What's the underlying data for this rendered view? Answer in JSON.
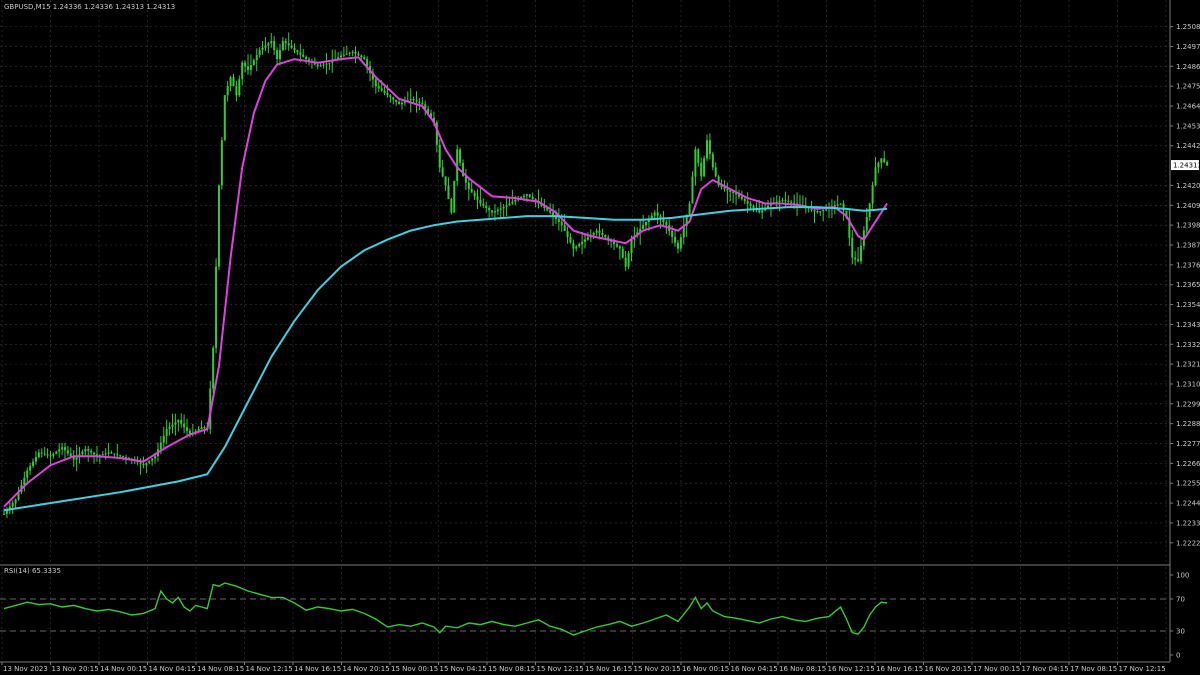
{
  "header": {
    "symbol_info": "GBPUSD,M15  1.24336 1.24336 1.24313 1.24313"
  },
  "rsi_panel": {
    "title": "RSI(14) 65.3335"
  },
  "colors": {
    "background": "#000000",
    "grid": "#3a3a3a",
    "candle": "#33cc33",
    "ma_fast": "#e040e0",
    "ma_slow": "#40d0e0",
    "rsi": "#33cc33",
    "price_tag_bg": "#ffffff",
    "price_tag_fg": "#000000"
  },
  "chart_data": [
    {
      "type": "line",
      "name": "price",
      "y_ticks": [
        "1.25080",
        "1.24970",
        "1.24860",
        "1.24750",
        "1.24640",
        "1.24530",
        "1.24420",
        "1.24200",
        "1.24090",
        "1.23980",
        "1.23870",
        "1.23760",
        "1.23650",
        "1.23540",
        "1.23430",
        "1.23320",
        "1.23210",
        "1.23100",
        "1.22990",
        "1.22880",
        "1.22770",
        "1.22660",
        "1.22550",
        "1.22440",
        "1.22330",
        "1.22220"
      ],
      "current_price": "1.24313",
      "ylim": [
        1.2218,
        1.2515
      ],
      "x_range": [
        0,
        100
      ],
      "x_ticks": [
        {
          "x": 0,
          "label": "13 Nov 2023"
        },
        {
          "x": 6.8,
          "label": "13 Nov 20:15"
        },
        {
          "x": 13.6,
          "label": "14 Nov 00:15"
        },
        {
          "x": 20.4,
          "label": "14 Nov 04:15"
        },
        {
          "x": 27.2,
          "label": "14 Nov 08:15"
        },
        {
          "x": 34.0,
          "label": "14 Nov 12:15"
        },
        {
          "x": 40.8,
          "label": "14 Nov 16:15"
        },
        {
          "x": 47.6,
          "label": "14 Nov 20:15"
        },
        {
          "x": 54.4,
          "label": "15 Nov 00:15"
        },
        {
          "x": 61.2,
          "label": "15 Nov 04:15"
        },
        {
          "x": 68.0,
          "label": "15 Nov 08:15"
        },
        {
          "x": 74.8,
          "label": "15 Nov 12:15"
        },
        {
          "x": 81.6,
          "label": "15 Nov 16:15"
        },
        {
          "x": 88.4,
          "label": "15 Nov 20:15"
        },
        {
          "x": 95.2,
          "label": "16 Nov 00:15"
        },
        {
          "x": 102.0,
          "label": "16 Nov 04:15"
        },
        {
          "x": 108.8,
          "label": "16 Nov 08:15"
        },
        {
          "x": 115.6,
          "label": "16 Nov 12:15"
        },
        {
          "x": 122.4,
          "label": "16 Nov 16:15"
        },
        {
          "x": 129.2,
          "label": "16 Nov 20:15"
        },
        {
          "x": 136.0,
          "label": "17 Nov 00:15"
        },
        {
          "x": 142.8,
          "label": "17 Nov 04:15"
        },
        {
          "x": 149.6,
          "label": "17 Nov 08:15"
        },
        {
          "x": 156.4,
          "label": "17 Nov 12:15"
        }
      ],
      "x_max": 200,
      "close": [
        [
          0,
          1.2238
        ],
        [
          2,
          1.2246
        ],
        [
          4,
          1.2262
        ],
        [
          6,
          1.2272
        ],
        [
          8,
          1.227
        ],
        [
          10,
          1.2275
        ],
        [
          12,
          1.2268
        ],
        [
          14,
          1.2274
        ],
        [
          16,
          1.227
        ],
        [
          18,
          1.2272
        ],
        [
          20,
          1.227
        ],
        [
          22,
          1.2268
        ],
        [
          24,
          1.2265
        ],
        [
          26,
          1.227
        ],
        [
          28,
          1.2285
        ],
        [
          30,
          1.229
        ],
        [
          32,
          1.2282
        ],
        [
          34,
          1.2286
        ],
        [
          35,
          1.2285
        ],
        [
          36,
          1.233
        ],
        [
          37,
          1.242
        ],
        [
          38,
          1.247
        ],
        [
          39,
          1.248
        ],
        [
          40,
          1.247
        ],
        [
          41,
          1.2488
        ],
        [
          42,
          1.2484
        ],
        [
          44,
          1.2495
        ],
        [
          46,
          1.25
        ],
        [
          47,
          1.249
        ],
        [
          48,
          1.25
        ],
        [
          50,
          1.2495
        ],
        [
          52,
          1.249
        ],
        [
          54,
          1.2486
        ],
        [
          56,
          1.2488
        ],
        [
          58,
          1.2492
        ],
        [
          60,
          1.2494
        ],
        [
          62,
          1.249
        ],
        [
          64,
          1.2475
        ],
        [
          66,
          1.247
        ],
        [
          68,
          1.2465
        ],
        [
          70,
          1.2468
        ],
        [
          72,
          1.2465
        ],
        [
          74,
          1.2455
        ],
        [
          75,
          1.243
        ],
        [
          76,
          1.242
        ],
        [
          77,
          1.2405
        ],
        [
          78,
          1.244
        ],
        [
          79,
          1.2425
        ],
        [
          80,
          1.2418
        ],
        [
          82,
          1.241
        ],
        [
          84,
          1.2405
        ],
        [
          86,
          1.2408
        ],
        [
          88,
          1.2412
        ],
        [
          90,
          1.2415
        ],
        [
          92,
          1.241
        ],
        [
          94,
          1.2405
        ],
        [
          96,
          1.2398
        ],
        [
          98,
          1.2385
        ],
        [
          100,
          1.239
        ],
        [
          102,
          1.2395
        ],
        [
          104,
          1.239
        ],
        [
          106,
          1.2385
        ],
        [
          107,
          1.2375
        ],
        [
          108,
          1.239
        ],
        [
          110,
          1.2398
        ],
        [
          112,
          1.2405
        ],
        [
          114,
          1.2398
        ],
        [
          116,
          1.2385
        ],
        [
          118,
          1.241
        ],
        [
          119,
          1.244
        ],
        [
          120,
          1.2425
        ],
        [
          121,
          1.2445
        ],
        [
          122,
          1.243
        ],
        [
          123,
          1.242
        ],
        [
          124,
          1.2418
        ],
        [
          126,
          1.2415
        ],
        [
          128,
          1.241
        ],
        [
          130,
          1.2405
        ],
        [
          132,
          1.241
        ],
        [
          134,
          1.2412
        ],
        [
          136,
          1.241
        ],
        [
          138,
          1.2408
        ],
        [
          140,
          1.2405
        ],
        [
          142,
          1.2408
        ],
        [
          144,
          1.241
        ],
        [
          145,
          1.2402
        ],
        [
          146,
          1.238
        ],
        [
          147,
          1.2378
        ],
        [
          148,
          1.2395
        ],
        [
          149,
          1.241
        ],
        [
          150,
          1.243
        ],
        [
          151,
          1.2435
        ],
        [
          152,
          1.2431
        ]
      ],
      "series": [
        {
          "name": "",
          "color_key": "ma_fast",
          "points": [
            [
              0,
              1.2242
            ],
            [
              4,
              1.2255
            ],
            [
              8,
              1.2265
            ],
            [
              12,
              1.227
            ],
            [
              16,
              1.227
            ],
            [
              20,
              1.2269
            ],
            [
              24,
              1.2267
            ],
            [
              28,
              1.2275
            ],
            [
              32,
              1.2282
            ],
            [
              35,
              1.2285
            ],
            [
              37,
              1.232
            ],
            [
              39,
              1.238
            ],
            [
              41,
              1.243
            ],
            [
              43,
              1.246
            ],
            [
              45,
              1.2478
            ],
            [
              47,
              1.2487
            ],
            [
              50,
              1.249
            ],
            [
              54,
              1.2488
            ],
            [
              58,
              1.249
            ],
            [
              61,
              1.2491
            ],
            [
              64,
              1.248
            ],
            [
              68,
              1.2468
            ],
            [
              72,
              1.2464
            ],
            [
              74,
              1.2455
            ],
            [
              76,
              1.244
            ],
            [
              78,
              1.243
            ],
            [
              80,
              1.2424
            ],
            [
              84,
              1.2414
            ],
            [
              88,
              1.2413
            ],
            [
              92,
              1.2411
            ],
            [
              95,
              1.2405
            ],
            [
              98,
              1.2395
            ],
            [
              101,
              1.2392
            ],
            [
              104,
              1.239
            ],
            [
              107,
              1.2388
            ],
            [
              110,
              1.2395
            ],
            [
              113,
              1.2398
            ],
            [
              116,
              1.2395
            ],
            [
              118,
              1.24
            ],
            [
              120,
              1.2418
            ],
            [
              122,
              1.2423
            ],
            [
              125,
              1.2418
            ],
            [
              128,
              1.2413
            ],
            [
              131,
              1.241
            ],
            [
              134,
              1.241
            ],
            [
              137,
              1.2409
            ],
            [
              140,
              1.2407
            ],
            [
              143,
              1.2408
            ],
            [
              145,
              1.2403
            ],
            [
              147,
              1.2392
            ],
            [
              148,
              1.239
            ],
            [
              149,
              1.2395
            ],
            [
              151,
              1.2405
            ],
            [
              152,
              1.241
            ]
          ]
        },
        {
          "name": "",
          "color_key": "ma_slow",
          "points": [
            [
              0,
              1.224
            ],
            [
              10,
              1.2245
            ],
            [
              20,
              1.225
            ],
            [
              30,
              1.2256
            ],
            [
              35,
              1.226
            ],
            [
              38,
              1.2275
            ],
            [
              42,
              1.23
            ],
            [
              46,
              1.2325
            ],
            [
              50,
              1.2345
            ],
            [
              54,
              1.2362
            ],
            [
              58,
              1.2375
            ],
            [
              62,
              1.2384
            ],
            [
              66,
              1.239
            ],
            [
              70,
              1.2395
            ],
            [
              74,
              1.2398
            ],
            [
              78,
              1.24
            ],
            [
              82,
              1.2401
            ],
            [
              86,
              1.2402
            ],
            [
              90,
              1.2403
            ],
            [
              95,
              1.2403
            ],
            [
              100,
              1.2402
            ],
            [
              105,
              1.2401
            ],
            [
              110,
              1.2401
            ],
            [
              115,
              1.2402
            ],
            [
              120,
              1.2404
            ],
            [
              125,
              1.2406
            ],
            [
              130,
              1.2407
            ],
            [
              135,
              1.2408
            ],
            [
              140,
              1.2408
            ],
            [
              145,
              1.2407
            ],
            [
              148,
              1.2406
            ],
            [
              152,
              1.2407
            ]
          ]
        }
      ]
    },
    {
      "type": "line",
      "name": "RSI(14)",
      "ylim": [
        0,
        100
      ],
      "y_ticks": [
        "100",
        "70",
        "30",
        "0"
      ],
      "levels": [
        70,
        30
      ],
      "x_max": 200,
      "values": [
        [
          0,
          58
        ],
        [
          2,
          62
        ],
        [
          4,
          66
        ],
        [
          6,
          63
        ],
        [
          8,
          64
        ],
        [
          10,
          60
        ],
        [
          12,
          62
        ],
        [
          14,
          58
        ],
        [
          16,
          55
        ],
        [
          18,
          57
        ],
        [
          20,
          54
        ],
        [
          22,
          50
        ],
        [
          24,
          52
        ],
        [
          26,
          58
        ],
        [
          27,
          80
        ],
        [
          28,
          70
        ],
        [
          29,
          65
        ],
        [
          30,
          72
        ],
        [
          31,
          60
        ],
        [
          32,
          55
        ],
        [
          33,
          62
        ],
        [
          34,
          60
        ],
        [
          35,
          58
        ],
        [
          36,
          88
        ],
        [
          37,
          86
        ],
        [
          38,
          90
        ],
        [
          40,
          86
        ],
        [
          42,
          80
        ],
        [
          44,
          76
        ],
        [
          46,
          72
        ],
        [
          48,
          72
        ],
        [
          50,
          65
        ],
        [
          52,
          56
        ],
        [
          54,
          60
        ],
        [
          56,
          58
        ],
        [
          58,
          55
        ],
        [
          60,
          57
        ],
        [
          62,
          52
        ],
        [
          64,
          45
        ],
        [
          66,
          35
        ],
        [
          68,
          38
        ],
        [
          70,
          36
        ],
        [
          72,
          40
        ],
        [
          74,
          35
        ],
        [
          75,
          28
        ],
        [
          76,
          36
        ],
        [
          78,
          34
        ],
        [
          80,
          40
        ],
        [
          82,
          38
        ],
        [
          84,
          42
        ],
        [
          86,
          38
        ],
        [
          88,
          36
        ],
        [
          90,
          40
        ],
        [
          92,
          44
        ],
        [
          94,
          36
        ],
        [
          96,
          32
        ],
        [
          98,
          25
        ],
        [
          100,
          30
        ],
        [
          102,
          35
        ],
        [
          104,
          38
        ],
        [
          106,
          42
        ],
        [
          108,
          36
        ],
        [
          110,
          40
        ],
        [
          112,
          45
        ],
        [
          114,
          50
        ],
        [
          116,
          42
        ],
        [
          118,
          60
        ],
        [
          119,
          72
        ],
        [
          120,
          58
        ],
        [
          121,
          65
        ],
        [
          122,
          55
        ],
        [
          124,
          48
        ],
        [
          126,
          46
        ],
        [
          128,
          43
        ],
        [
          130,
          40
        ],
        [
          132,
          45
        ],
        [
          134,
          48
        ],
        [
          136,
          44
        ],
        [
          138,
          42
        ],
        [
          140,
          46
        ],
        [
          142,
          48
        ],
        [
          144,
          60
        ],
        [
          145,
          45
        ],
        [
          146,
          28
        ],
        [
          147,
          26
        ],
        [
          148,
          35
        ],
        [
          149,
          50
        ],
        [
          150,
          60
        ],
        [
          151,
          66
        ],
        [
          152,
          65
        ]
      ]
    }
  ]
}
